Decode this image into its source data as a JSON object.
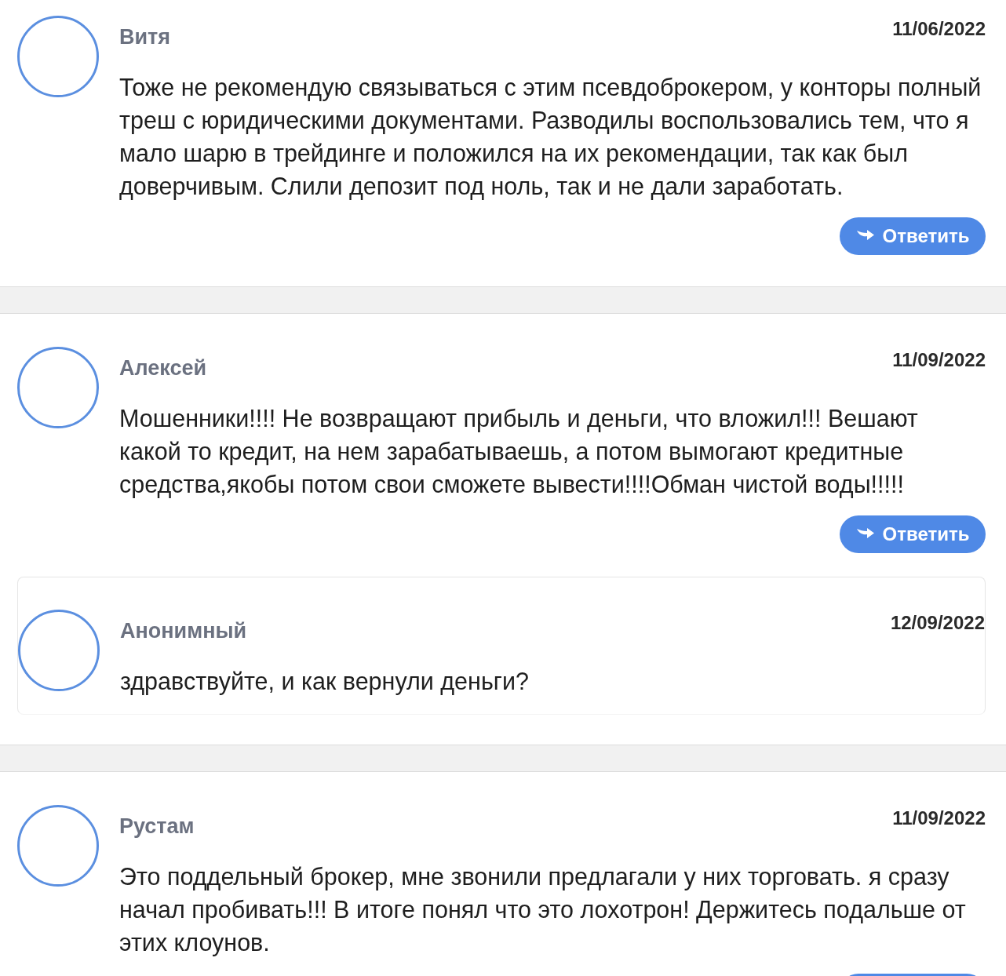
{
  "threads": [
    {
      "author": "Витя",
      "date": "11/06/2022",
      "text": "Тоже не рекомендую связываться с этим псевдоброкером, у конторы полный треш с юридическими документами. Разводилы воспользовались тем, что я мало шарю в трейдинге и положился на их рекомендации, так как был доверчивым. Слили депозит под ноль, так и не дали заработать.",
      "reply_label": "Ответить"
    },
    {
      "author": "Алексей",
      "date": "11/09/2022",
      "text": "Мошенники!!!! Не возвращают прибыль и деньги, что вложил!!! Вешают какой то кредит, на нем зарабатываешь, а потом вымогают кредитные средства,якобы потом свои сможете вывести!!!!Обман чистой воды!!!!!",
      "reply_label": "Ответить",
      "replies": [
        {
          "author": "Анонимный",
          "date": "12/09/2022",
          "text": "здравствуйте, и как вернули деньги?"
        }
      ]
    },
    {
      "author": "Рустам",
      "date": "11/09/2022",
      "text": "Это поддельный брокер, мне звонили предлагали у них торговать. я сразу начал пробивать!!! В итоге понял что это лохотрон! Держитесь подальше от этих клоунов.",
      "reply_button": true
    }
  ]
}
